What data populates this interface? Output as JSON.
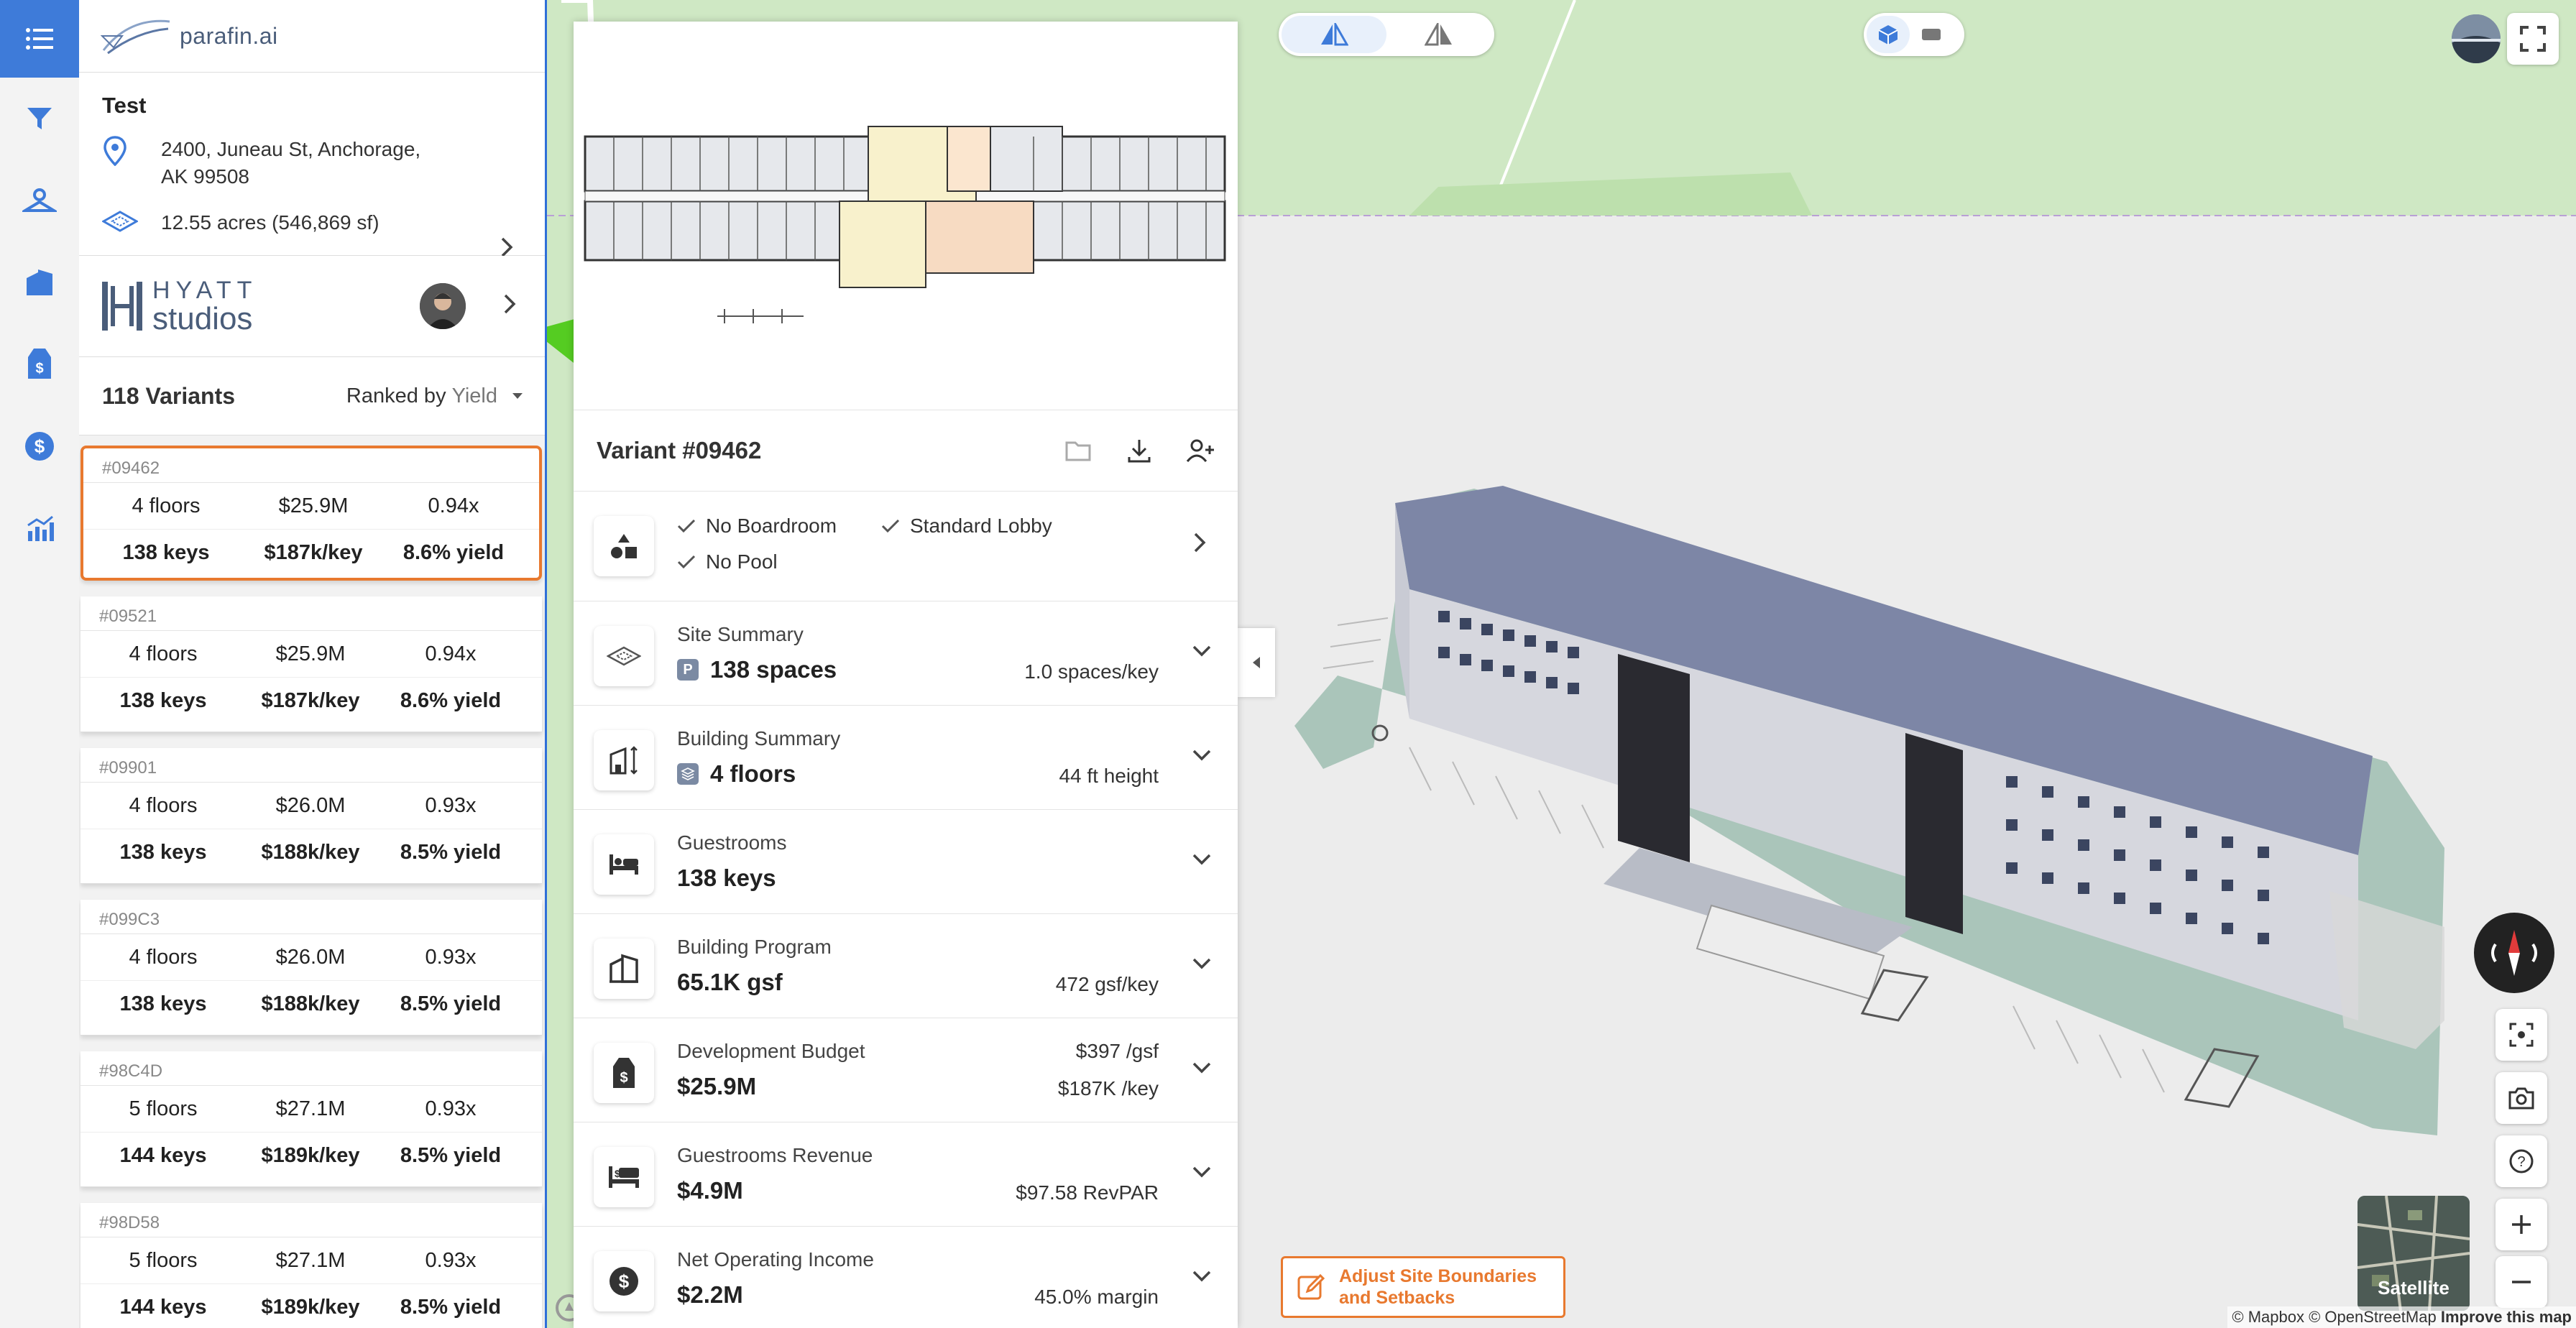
{
  "app": {
    "logo_text": "parafin.ai"
  },
  "project": {
    "name": "Test",
    "address": "2400, Juneau St, Anchorage, AK 99508",
    "area": "12.55 acres (546,869 sf)"
  },
  "brand": {
    "logo_line1": "HYATT",
    "logo_line2": "studios"
  },
  "variants": {
    "count_label": "118 Variants",
    "ranked_label": "Ranked by",
    "ranked_value": "Yield",
    "items": [
      {
        "id": "#09462",
        "floors": "4 floors",
        "cost": "$25.9M",
        "ratio": "0.94x",
        "keys": "138 keys",
        "per_key": "$187k/key",
        "yield": "8.6% yield"
      },
      {
        "id": "#09521",
        "floors": "4 floors",
        "cost": "$25.9M",
        "ratio": "0.94x",
        "keys": "138 keys",
        "per_key": "$187k/key",
        "yield": "8.6% yield"
      },
      {
        "id": "#09901",
        "floors": "4 floors",
        "cost": "$26.0M",
        "ratio": "0.93x",
        "keys": "138 keys",
        "per_key": "$188k/key",
        "yield": "8.5% yield"
      },
      {
        "id": "#099C3",
        "floors": "4 floors",
        "cost": "$26.0M",
        "ratio": "0.93x",
        "keys": "138 keys",
        "per_key": "$188k/key",
        "yield": "8.5% yield"
      },
      {
        "id": "#98C4D",
        "floors": "5 floors",
        "cost": "$27.1M",
        "ratio": "0.93x",
        "keys": "144 keys",
        "per_key": "$189k/key",
        "yield": "8.5% yield"
      },
      {
        "id": "#98D58",
        "floors": "5 floors",
        "cost": "$27.1M",
        "ratio": "0.93x",
        "keys": "144 keys",
        "per_key": "$189k/key",
        "yield": "8.5% yield"
      }
    ]
  },
  "detail": {
    "title": "Variant #09462",
    "amenities": [
      "No Boardroom",
      "Standard Lobby",
      "No Pool"
    ],
    "sections": {
      "site": {
        "title": "Site Summary",
        "value": "138 spaces",
        "right": "1.0 spaces/key",
        "badge": "P"
      },
      "building": {
        "title": "Building Summary",
        "value": "4 floors",
        "right": "44 ft height"
      },
      "guestrooms": {
        "title": "Guestrooms",
        "value": "138 keys"
      },
      "program": {
        "title": "Building Program",
        "value": "65.1K gsf",
        "right": "472 gsf/key"
      },
      "budget": {
        "title": "Development Budget",
        "value": "$25.9M",
        "right_top": "$397 /gsf",
        "right": "$187K /key"
      },
      "revenue": {
        "title": "Guestrooms Revenue",
        "value": "$4.9M",
        "right": "$97.58 RevPAR"
      },
      "noi": {
        "title": "Net Operating Income",
        "value": "$2.2M",
        "right": "45.0% margin"
      }
    }
  },
  "map": {
    "adjust_label_1": "Adjust Site Boundaries",
    "adjust_label_2": "and Setbacks",
    "satellite_label": "Satellite",
    "mapbox_label": "mapbox",
    "attribution_1": "© Mapbox © OpenStreetMap",
    "attribution_2": "Improve this map"
  },
  "colors": {
    "accent": "#3e7bd9",
    "selected": "#e8792f",
    "arrow": "#55cc22"
  }
}
